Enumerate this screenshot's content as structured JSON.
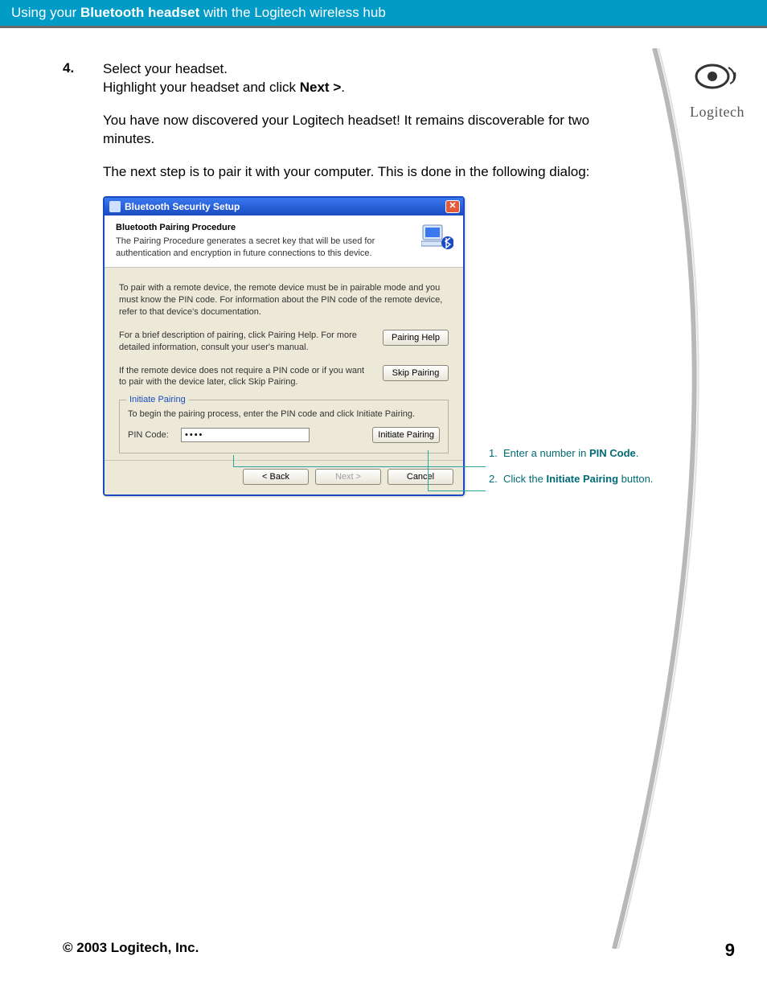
{
  "header": {
    "prefix": "Using your ",
    "bold": "Bluetooth headset",
    "suffix": " with the Logitech wireless hub"
  },
  "logo": {
    "text": "Logitech"
  },
  "step": {
    "number": "4.",
    "line1a": "Select your headset.",
    "line1b_pre": "Highlight your headset and click ",
    "line1b_bold": "Next >",
    "line1b_post": ".",
    "para2": "You have now discovered your Logitech headset! It remains discoverable for two minutes.",
    "para3": "The next step is to pair it with your computer. This is done in the following dialog:"
  },
  "dialog": {
    "title": "Bluetooth Security Setup",
    "top_header": "Bluetooth Pairing Procedure",
    "top_desc": "The Pairing Procedure generates a secret key that will be used for authentication and encryption in future connections to this device.",
    "p1": "To pair with a remote device, the remote device must be in pairable mode and you must know the PIN code.  For information about the PIN code of the remote device, refer to that device's documentation.",
    "p2": "For a brief description of pairing, click Pairing Help.  For more detailed information, consult your user's manual.",
    "btn_help": "Pairing Help",
    "p3": "If the remote device does not require a PIN code or if you want to pair with the device later, click Skip Pairing.",
    "btn_skip": "Skip Pairing",
    "fieldset_legend": "Initiate Pairing",
    "fs_instr": "To begin the pairing process, enter the PIN code and click Initiate Pairing.",
    "pin_label": "PIN Code:",
    "pin_value": "••••",
    "btn_initiate": "Initiate Pairing",
    "btn_back": "< Back",
    "btn_next": "Next >",
    "btn_cancel": "Cancel"
  },
  "callouts": {
    "c1_num": "1.",
    "c1_pre": "Enter a number in ",
    "c1_bold": "PIN Code",
    "c1_post": ".",
    "c2_num": "2.",
    "c2_pre": "Click the ",
    "c2_bold": "Initiate Pairing",
    "c2_post": " button."
  },
  "footer": {
    "copyright": "© 2003 Logitech, Inc.",
    "page": "9"
  }
}
